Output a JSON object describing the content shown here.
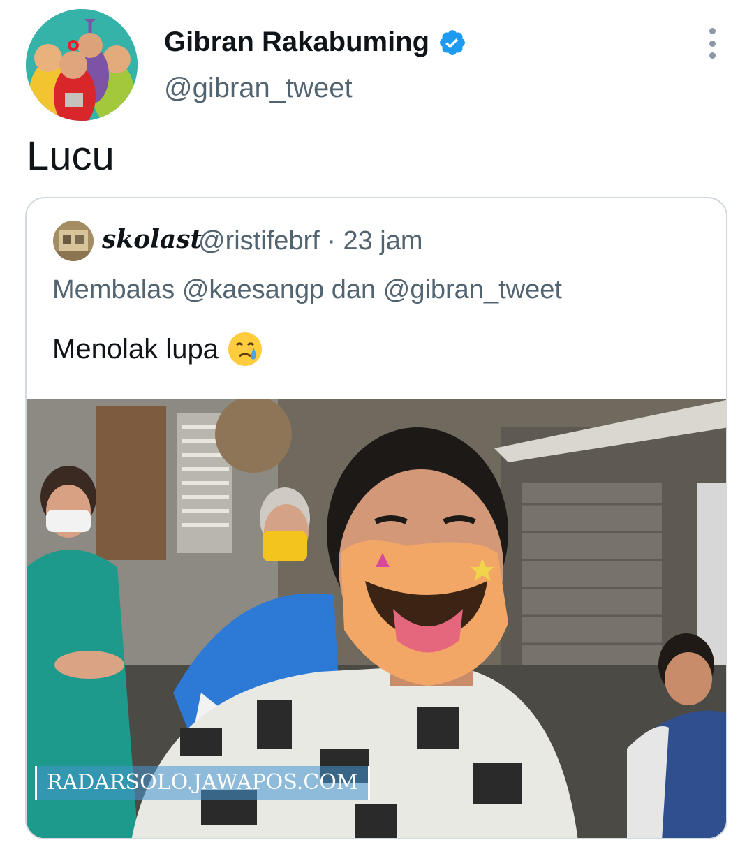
{
  "tweet": {
    "author": {
      "display_name": "Gibran Rakabuming",
      "handle": "@gibran_tweet",
      "verified": true,
      "avatar_icon": "teletubbies-avatar-icon"
    },
    "text": "Lucu",
    "more_icon": "more-options-icon"
  },
  "quoted_tweet": {
    "author": {
      "display_name": "skolast",
      "handle": "@ristifebrf",
      "avatar_icon": "user-avatar-icon"
    },
    "meta": "@ristifebrf · 23 jam",
    "replying_to": "Membalas @kaesangp dan @gibran_tweet",
    "text": "Menolak lupa",
    "emoji": "face-holding-back-tears",
    "media": {
      "watermark": "RADARSOLO.JAWAPOS.COM"
    }
  },
  "colors": {
    "text_primary": "#0f1419",
    "text_secondary": "#536471",
    "verified_blue": "#1d9bf0",
    "border": "#cfd9de"
  }
}
